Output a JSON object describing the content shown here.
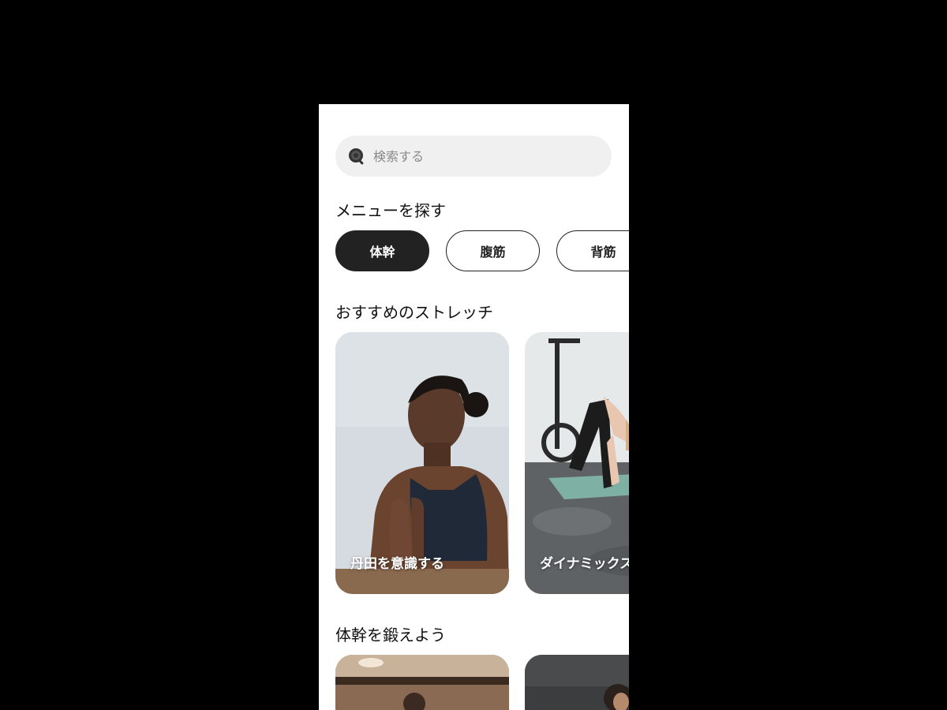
{
  "search": {
    "placeholder": "検索する"
  },
  "sections": {
    "menu_title": "メニューを探す",
    "stretch_title": "おすすめのストレッチ",
    "core_title": "体幹を鍛えよう"
  },
  "chips": [
    {
      "label": "体幹",
      "active": true
    },
    {
      "label": "腹筋",
      "active": false
    },
    {
      "label": "背筋",
      "active": false
    }
  ],
  "stretch_cards": [
    {
      "label": "丹田を意識する"
    },
    {
      "label": "ダイナミックス"
    }
  ],
  "colors": {
    "background": "#000000",
    "screen": "#ffffff",
    "search_bg": "#f0f0f0",
    "chip_active_bg": "#222222",
    "text": "#111111"
  }
}
